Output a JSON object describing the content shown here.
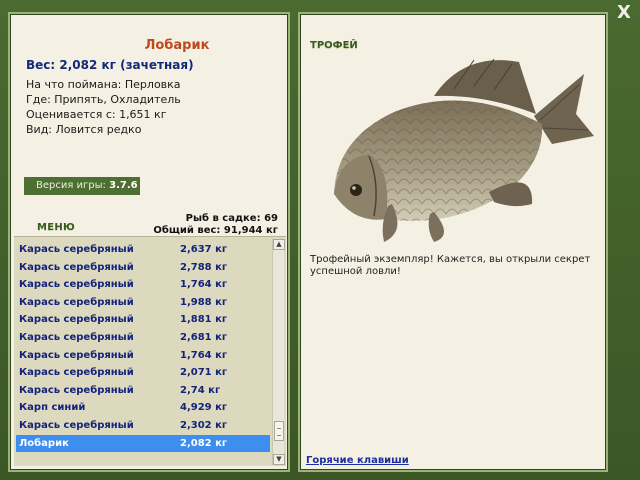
{
  "close_label": "X",
  "fish_info": {
    "title": "Лобарик",
    "weight": "Вес: 2,082 кг (зачетная)",
    "lines": [
      "На что поймана: Перловка",
      "Где: Припять, Охладитель",
      "Оценивается с: 1,651 кг",
      "Вид: Ловится редко"
    ]
  },
  "version": {
    "label": "Версия игры: ",
    "value": "3.7.6"
  },
  "menu_label": "МЕНЮ",
  "stats": {
    "fish_in_keepnet": "Рыб в садке: 69",
    "total_weight": "Общий вес: 91,944 кг"
  },
  "catch_list": [
    {
      "name": "Карась серебряный",
      "weight": "2,637 кг"
    },
    {
      "name": "Карась серебряный",
      "weight": "2,788 кг"
    },
    {
      "name": "Карась серебряный",
      "weight": "1,764 кг"
    },
    {
      "name": "Карась серебряный",
      "weight": "1,988 кг"
    },
    {
      "name": "Карась серебряный",
      "weight": "1,881 кг"
    },
    {
      "name": "Карась серебряный",
      "weight": "2,681 кг"
    },
    {
      "name": "Карась серебряный",
      "weight": "1,764 кг"
    },
    {
      "name": "Карась серебряный",
      "weight": "2,071 кг"
    },
    {
      "name": "Карась серебряный",
      "weight": "2,74 кг"
    },
    {
      "name": "Карп синий",
      "weight": "4,929 кг"
    },
    {
      "name": "Карась серебряный",
      "weight": "2,302 кг"
    },
    {
      "name": "Лобарик",
      "weight": "2,082 кг"
    }
  ],
  "selected_index": 11,
  "trophy": {
    "label": "ТРОФЕЙ",
    "text": "Трофейный экземпляр! Кажется, вы открыли секрет успешной ловли!",
    "image_icon": "fish-carp-image"
  },
  "hotkeys_label": "Горячие клавиши",
  "colors": {
    "frame": "#3f5a2b",
    "panel": "#f4f1e4",
    "title": "#c0481c",
    "list_text": "#13237a",
    "selection": "#3e8ef0"
  }
}
